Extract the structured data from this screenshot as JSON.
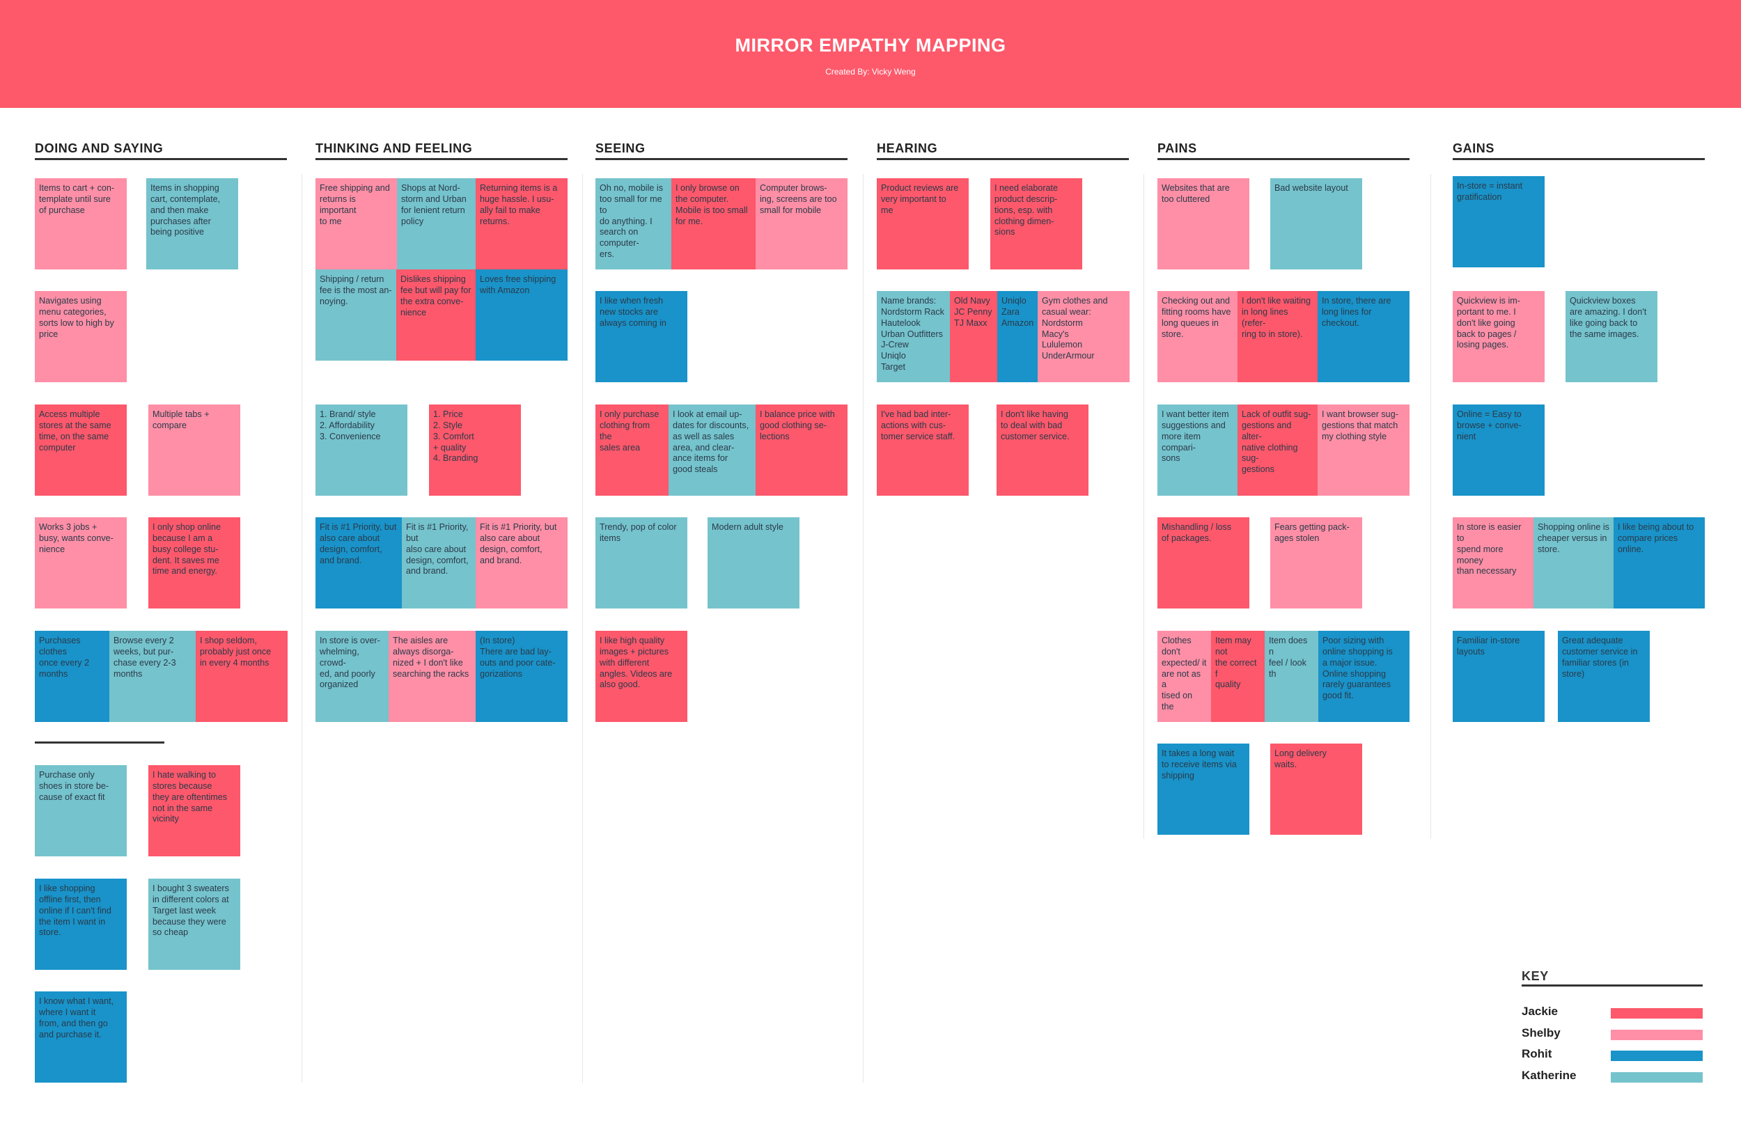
{
  "header": {
    "title": "MIRROR EMPATHY MAPPING",
    "subtitle": "Created By: Vicky Weng"
  },
  "colors": {
    "banner": "#fd596b",
    "jackie": "#fd586b",
    "shelby": "#fe8fa6",
    "rohit": "#1993c9",
    "katherine": "#75c3cc"
  },
  "columns": [
    {
      "title": "DOING AND SAYING"
    },
    {
      "title": "THINKING AND FEELING"
    },
    {
      "title": "SEEING"
    },
    {
      "title": "HEARING"
    },
    {
      "title": "PAINS"
    },
    {
      "title": "GAINS"
    }
  ],
  "notes": [
    {
      "text": "Items to cart + con-\ntemplate until sure\nof purchase",
      "person": "shelby"
    },
    {
      "text": "Items in shopping\ncart, contemplate,\nand then make\npurchases after\nbeing positive",
      "person": "katherine"
    },
    {
      "text": "Navigates using\nmenu categories,\nsorts low to high by\nprice",
      "person": "shelby"
    },
    {
      "text": "Access multiple\nstores at the same\ntime, on the same\ncomputer",
      "person": "jackie"
    },
    {
      "text": "Multiple tabs +\ncompare",
      "person": "shelby"
    },
    {
      "text": "Works 3 jobs +\nbusy, wants conve-\nnience",
      "person": "shelby"
    },
    {
      "text": "I only shop online\nbecause I am a\nbusy college stu-\ndent. It saves me\ntime and energy.",
      "person": "jackie"
    },
    {
      "text": "Purchases clothes\nonce every 2\nmonths",
      "person": "rohit"
    },
    {
      "text": "Browse every 2\nweeks, but pur-\nchase every 2-3\nmonths",
      "person": "katherine"
    },
    {
      "text": "I shop seldom,\nprobably just once\nin every 4 months",
      "person": "jackie"
    },
    {
      "text": "Purchase only\nshoes in store be-\ncause of exact fit",
      "person": "katherine"
    },
    {
      "text": "I hate walking to\nstores because\nthey are oftentimes\nnot in the same\nvicinity",
      "person": "jackie"
    },
    {
      "text": "I like shopping\noffline first, then\nonline if I can't find\nthe item I want in\nstore.",
      "person": "rohit"
    },
    {
      "text": "I bought 3 sweaters\nin different colors at\nTarget last week\nbecause they were\nso cheap",
      "person": "katherine"
    },
    {
      "text": "I know what I want,\nwhere I want it\nfrom, and then go\nand purchase it.",
      "person": "rohit"
    },
    {
      "text": "Free shipping and\nreturns is important\nto me",
      "person": "shelby"
    },
    {
      "text": "Shops at Nord-\nstorm and Urban\nfor lenient return\npolicy",
      "person": "katherine"
    },
    {
      "text": "Returning items is a\nhuge hassle. I usu-\nally fail to make\nreturns.",
      "person": "jackie"
    },
    {
      "text": "Shipping / return\nfee is the most an-\nnoying.",
      "person": "katherine"
    },
    {
      "text": "Dislikes shipping\nfee but will pay for\nthe extra conve-\nnience",
      "person": "jackie"
    },
    {
      "text": "Loves free shipping\nwith Amazon",
      "person": "rohit"
    },
    {
      "text": "1. Brand/ style\n2. Affordability\n3. Convenience",
      "person": "katherine"
    },
    {
      "text": "1. Price\n2. Style\n3. Comfort\n+ quality\n4. Branding",
      "person": "jackie"
    },
    {
      "text": "Fit is #1 Priority, but\nalso care about\ndesign, comfort,\nand brand.",
      "person": "rohit"
    },
    {
      "text": "Fit is #1 Priority, but\nalso care about\ndesign, comfort,\nand brand.",
      "person": "katherine"
    },
    {
      "text": "Fit is #1 Priority, but\nalso care about\ndesign, comfort,\nand brand.",
      "person": "shelby"
    },
    {
      "text": "In store is over-\nwhelming, crowd-\ned, and poorly\norganized",
      "person": "katherine"
    },
    {
      "text": "The aisles are\nalways disorga-\nnized + I don't like\nsearching the racks",
      "person": "shelby"
    },
    {
      "text": "(In store)\nThere are bad lay-\nouts and poor cate-\ngorizations",
      "person": "rohit"
    },
    {
      "text": "Oh no, mobile is\ntoo small for me to\ndo anything. I\nsearch on computer-\ners.",
      "person": "katherine"
    },
    {
      "text": "I only browse on\nthe computer.\nMobile is too small\nfor me.",
      "person": "jackie"
    },
    {
      "text": "Computer brows-\ning, screens are too\nsmall for mobile",
      "person": "shelby"
    },
    {
      "text": "I like when fresh\nnew stocks are\nalways coming in",
      "person": "rohit"
    },
    {
      "text": "I only purchase\nclothing from the\nsales area",
      "person": "jackie"
    },
    {
      "text": "I look at email up-\ndates for discounts,\nas well as sales\narea, and clear-\nance items for\ngood steals",
      "person": "katherine"
    },
    {
      "text": "I balance price with\ngood clothing se-\nlections",
      "person": "jackie"
    },
    {
      "text": "Trendy, pop of color\nitems",
      "person": "katherine"
    },
    {
      "text": "Modern adult style",
      "person": "katherine"
    },
    {
      "text": "I like high quality\nimages + pictures\nwith different\nangles. Videos are\nalso good.",
      "person": "jackie"
    },
    {
      "text": "Product reviews are\nvery important to\nme",
      "person": "jackie"
    },
    {
      "text": "I need elaborate\nproduct descrip-\ntions, esp. with\nclothing dimen-\nsions",
      "person": "jackie"
    },
    {
      "text": "Name brands:\nNordstorm Rack\nHautelook\nUrban Outfitters\nJ-Crew\nUniqlo\nTarget",
      "person": "katherine"
    },
    {
      "text": "Old Navy\nJC Penny\nTJ Maxx",
      "person": "jackie"
    },
    {
      "text": "Uniqlo\nZara\nAmazon",
      "person": "rohit"
    },
    {
      "text": "Gym clothes and\ncasual wear:\nNordstorm\nMacy's\nLululemon\nUnderArmour",
      "person": "shelby"
    },
    {
      "text": "I've had bad inter-\nactions with cus-\ntomer service staff.",
      "person": "jackie"
    },
    {
      "text": "I don't like having\nto deal with bad\ncustomer service.",
      "person": "jackie"
    },
    {
      "text": "Websites that are\ntoo cluttered",
      "person": "shelby"
    },
    {
      "text": "Bad website layout",
      "person": "katherine"
    },
    {
      "text": "Checking out and\nfitting rooms have\nlong queues in\nstore.",
      "person": "shelby"
    },
    {
      "text": "I don't like waiting\nin long lines (refer-\nring to in store).",
      "person": "jackie"
    },
    {
      "text": "In store, there are\nlong lines for\ncheckout.",
      "person": "rohit"
    },
    {
      "text": "I want better item\nsuggestions and\nmore item compari-\nsons",
      "person": "katherine"
    },
    {
      "text": "Lack of outfit sug-\ngestions and alter-\nnative clothing sug-\ngestions",
      "person": "jackie"
    },
    {
      "text": "I want browser sug-\ngestions that match\nmy clothing style",
      "person": "shelby"
    },
    {
      "text": "Mishandling / loss\nof packages.",
      "person": "jackie"
    },
    {
      "text": "Fears getting pack-\nages stolen",
      "person": "shelby"
    },
    {
      "text": "Clothes don't\nexpected/ it\nare not as a\ntised on the",
      "person": "shelby"
    },
    {
      "text": "Item may not\nthe correct f\nquality",
      "person": "jackie"
    },
    {
      "text": "Item does n\nfeel / look th",
      "person": "katherine"
    },
    {
      "text": "Poor sizing with\nonline shopping is\na major issue.\nOnline shopping\nrarely guarantees\ngood fit.",
      "person": "rohit"
    },
    {
      "text": "It takes a long wait\nto receive items via\nshipping",
      "person": "rohit"
    },
    {
      "text": "Long delivery\nwaits.",
      "person": "jackie"
    },
    {
      "text": "In-store = instant\ngratification",
      "person": "rohit"
    },
    {
      "text": "Quickview is im-\nportant to me. I\ndon't like going\nback to pages /\nlosing pages.",
      "person": "shelby"
    },
    {
      "text": "Quickview boxes\nare amazing. I don't\nlike going back to\nthe same images.",
      "person": "katherine"
    },
    {
      "text": "Online = Easy to\nbrowse + conve-\nnient",
      "person": "rohit"
    },
    {
      "text": "In store is easier to\nspend more money\nthan necessary",
      "person": "shelby"
    },
    {
      "text": "Shopping online is\ncheaper versus in\nstore.",
      "person": "katherine"
    },
    {
      "text": "I like being about to\ncompare prices\nonline.",
      "person": "rohit"
    },
    {
      "text": "Familiar in-store\nlayouts",
      "person": "rohit"
    },
    {
      "text": "Great adequate\ncustomer service in\nfamiliar stores (in\nstore)",
      "person": "rohit"
    }
  ],
  "key": {
    "title": "KEY",
    "items": [
      {
        "name": "Jackie",
        "person": "jackie"
      },
      {
        "name": "Shelby",
        "person": "shelby"
      },
      {
        "name": "Rohit",
        "person": "rohit"
      },
      {
        "name": "Katherine",
        "person": "katherine"
      }
    ]
  }
}
